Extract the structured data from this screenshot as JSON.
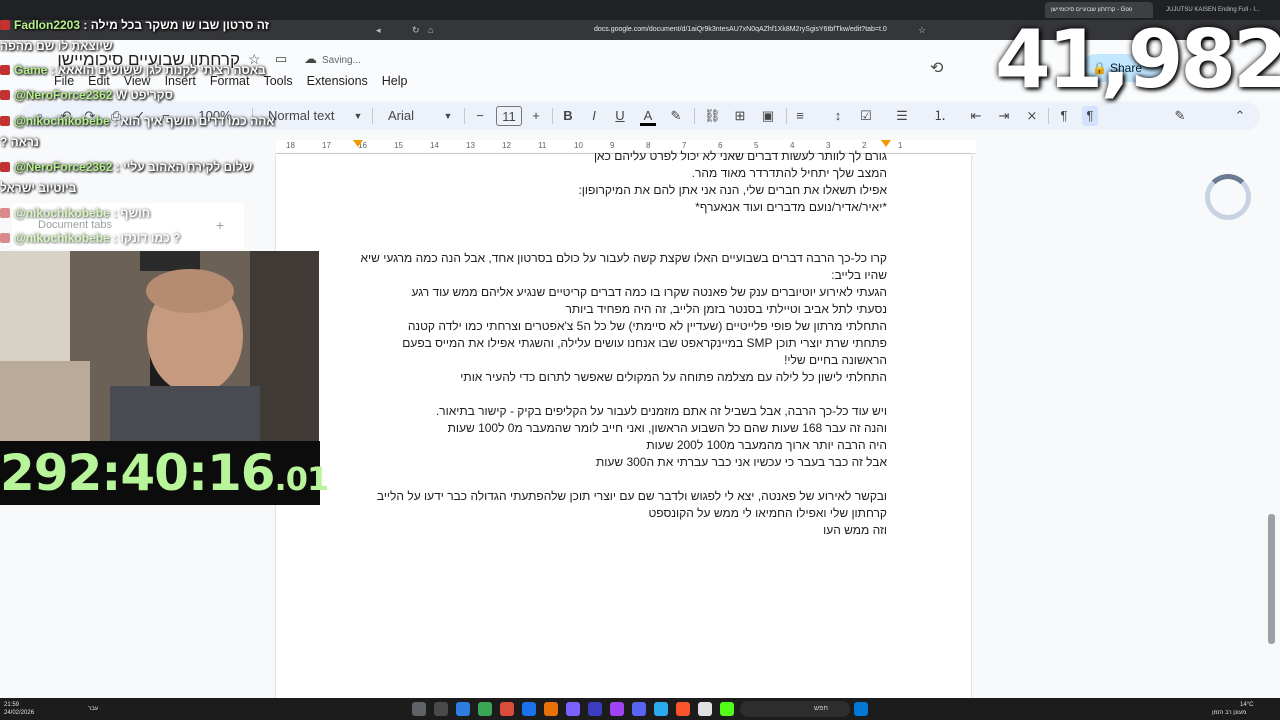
{
  "browser": {
    "tab_active": "קרחתון שבועיים סיכומיישן - Goo",
    "tab_other": "JUJUTSU KAISEN Ending Full - I...",
    "url": "docs.google.com/document/d/1aiQr9k3ntesAU7xN0qAZhf1Xk8M2rySgisY6tbfTkw/edit?tab=t.0"
  },
  "docs": {
    "title": "קרחתון שבועיים סיכומיישן",
    "saving": "Saving...",
    "menu": [
      "File",
      "Edit",
      "View",
      "Insert",
      "Format",
      "Tools",
      "Extensions",
      "Help"
    ],
    "share_label": "Share",
    "toolbar": {
      "zoom": "100%",
      "style": "Normal text",
      "font": "Arial",
      "size": "11",
      "bold": "B",
      "italic": "I",
      "underline": "U",
      "text_color": "A"
    },
    "ruler_numbers": [
      "18",
      "17",
      "16",
      "15",
      "14",
      "13",
      "12",
      "11",
      "10",
      "9",
      "8",
      "7",
      "6",
      "5",
      "4",
      "3",
      "2",
      "1"
    ],
    "document_tabs_label": "Document tabs",
    "lines": [
      "המצב שלך יתחיל להתדרדר מאוד מהר.",
      "אפילו תשאלו את חברים שלי, הנה אני אתן להם את המיקרופון:",
      "*יאיר/אדיר/נועם מדברים ועוד אנאערף*",
      "",
      "קרו כל-כך הרבה דברים בשבועיים האלו שקצת קשה לעבור על כולם בסרטון אחד, אבל הנה כמה מרגעי שיא",
      "שהיו בלייב:",
      "הגעתי לאירוע יוטיוברים ענק של פאנטה שקרו בו כמה דברים קריטיים שנגיע אליהם ממש עוד רגע",
      "נסעתי לתל אביב וטיילתי בסנטר בזמן הלייב, זה היה מפחיד ביותר",
      "התחלתי מרתון של פופי פלייטיים (שעדיין לא סיימתי) של כל ה5 צ'אפטרים וצרחתי כמו ילדה קטנה",
      "פתחתי שרת יוצרי תוכן SMP במיינקראפט שבו אנחנו עושים עלילה, והשגתי אפילו את המייס בפעם",
      "הראשונה בחיים שלי!",
      "התחלתי לישון כל לילה עם מצלמה פתוחה על המקולים שאפשר לתרום כדי להעיר אותי",
      "",
      "ויש עוד כל-כך הרבה, אבל בשביל זה אתם מוזמנים לעבור על הקליפים בקיק - קישור בתיאור.",
      "והנה זה עבר 168 שעות שהם כל השבוע הראשון, ואני חייב לומר שהמעבר מ0 ל100 שעות",
      "היה הרבה יותר ארוך מהמעבר מ100 ל200 שעות",
      "אבל זה כבר בעבר כי עכשיו אני כבר עברתי את ה300 שעות",
      "",
      "ובקשר לאירוע של פאנטה, יצא לי לפגוש ולדבר שם עם יוצרי תוכן שלהפתעתי הגדולה כבר ידעו על הלייב",
      "קרחתון שלי ואפילו החמיאו לי ממש על הקונספט",
      "וזה ממש העו"
    ],
    "top_partial_line": "גורם לך לוותר לעשות דברים שאני לא יכול לפרט עליהם כאן"
  },
  "stream": {
    "chat": [
      {
        "user": "Fadlon2203",
        "text": ": זה סרטון שבו שו משקר בכל מילה"
      },
      {
        "user": "",
        "text": "שיוצאת לו שם מהפה"
      },
      {
        "user": "Game",
        "text": ": באסה רציתי לקנות לגן ששושים הואאא"
      },
      {
        "user": "@NeroForce2362",
        "text": "W סקריפט"
      },
      {
        "user": "@nikochikobebe",
        "text": ": אהה כמו דרים חושף איך הוא"
      },
      {
        "user": "",
        "text": "? נראה"
      },
      {
        "user": "@NeroForce2362",
        "text": ": שלום לקירח האהוב עליי"
      },
      {
        "user": "",
        "text": "ביוטיוב ישראל"
      },
      {
        "user": "@nikochikobebe",
        "text": ": חושף"
      },
      {
        "user": "@nikochikobebe",
        "text": ": כמו דונקו ?"
      }
    ],
    "timer_main": "292:40:16",
    "timer_fraction": ".01",
    "counter": "41,982"
  },
  "taskbar": {
    "time": "21:59",
    "date": "24/02/2026",
    "lang": "עבר",
    "search": "חפש",
    "weather": "14°C",
    "weather_desc": "מעונן רב הזמן"
  }
}
